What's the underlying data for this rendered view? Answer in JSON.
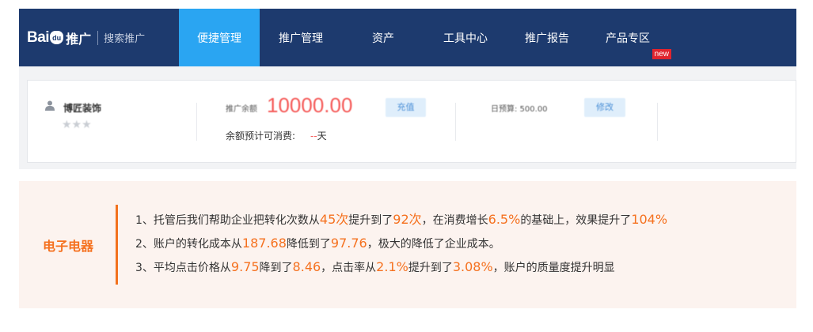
{
  "header": {
    "logo_bai": "Bai",
    "logo_du": "du",
    "logo_product": "推广",
    "logo_sub": "搜索推广",
    "nav": [
      {
        "label": "便捷管理",
        "active": true
      },
      {
        "label": "推广管理",
        "active": false
      },
      {
        "label": "资产",
        "active": false
      },
      {
        "label": "工具中心",
        "active": false
      },
      {
        "label": "推广报告",
        "active": false
      },
      {
        "label": "产品专区",
        "active": false,
        "badge": "new"
      }
    ]
  },
  "account": {
    "username": "博匠装饰",
    "stars": "★★★",
    "balance_label": "推广余额",
    "balance_value": "10000.00",
    "recharge_label": "充值",
    "estimate_label": "余额预计可消费:",
    "estimate_value": "--",
    "estimate_unit": "天",
    "daily_budget_label": "日预算: 500.00",
    "modify_label": "修改"
  },
  "result": {
    "industry": "电子电器",
    "lines": [
      [
        {
          "t": "1、托管后我们帮助企业把转化次数从"
        },
        {
          "t": "45次",
          "hl": true
        },
        {
          "t": "提升到了"
        },
        {
          "t": "92次",
          "hl": true
        },
        {
          "t": "，在消费增长"
        },
        {
          "t": "6.5%",
          "hl": true
        },
        {
          "t": "的基础上，效果提升了"
        },
        {
          "t": "104%",
          "hl": true
        }
      ],
      [
        {
          "t": "2、账户的转化成本从"
        },
        {
          "t": "187.68",
          "hl": true
        },
        {
          "t": "降低到了"
        },
        {
          "t": "97.76",
          "hl": true
        },
        {
          "t": "，极大的降低了企业成本。"
        }
      ],
      [
        {
          "t": "3、平均点击价格从"
        },
        {
          "t": "9.75",
          "hl": true
        },
        {
          "t": "降到了"
        },
        {
          "t": "8.46",
          "hl": true
        },
        {
          "t": "，点击率从"
        },
        {
          "t": "2.1%",
          "hl": true
        },
        {
          "t": "提升到了"
        },
        {
          "t": "3.08%",
          "hl": true
        },
        {
          "t": "，账户的质量度提升明显"
        }
      ]
    ]
  }
}
